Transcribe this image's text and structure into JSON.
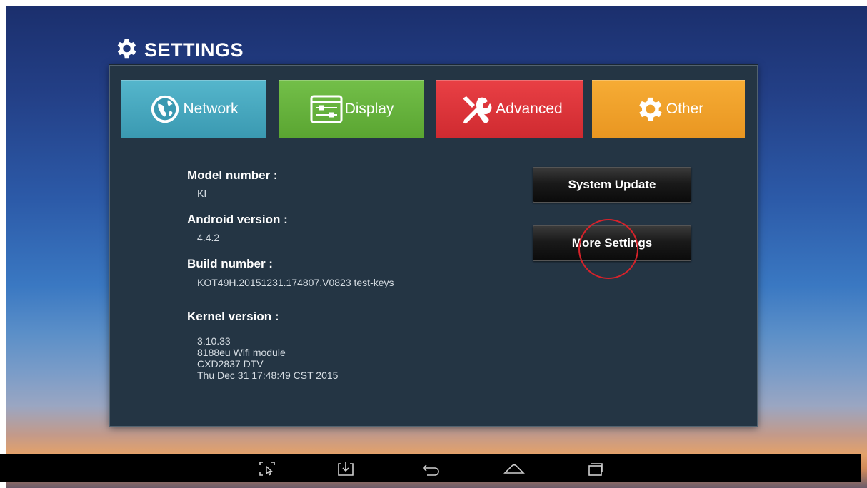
{
  "title": "SETTINGS",
  "tabs": [
    {
      "label": "Network",
      "icon": "globe-icon",
      "color": "#3fa3bb"
    },
    {
      "label": "Display",
      "icon": "display-settings-icon",
      "color": "#63ae3a"
    },
    {
      "label": "Advanced",
      "icon": "tools-icon",
      "color": "#dd3338"
    },
    {
      "label": "Other",
      "icon": "gear-icon",
      "color": "#f0a22a"
    }
  ],
  "info": {
    "model_label": "Model number :",
    "model_value": "KI",
    "android_label": "Android version :",
    "android_value": "4.4.2",
    "build_label": "Build number :",
    "build_value": "KOT49H.20151231.174807.V0823 test-keys",
    "kernel_label": "Kernel version :",
    "kernel_lines": [
      "3.10.33",
      "8188eu Wifi module",
      "CXD2837 DTV",
      "Thu Dec 31 17:48:49 CST 2015"
    ]
  },
  "buttons": {
    "system_update": "System Update",
    "more_settings": "More Settings"
  },
  "navbar": [
    "screenshot-icon",
    "download-icon",
    "back-icon",
    "home-icon",
    "recents-icon"
  ],
  "colors": {
    "panel": "#243544",
    "highlight_circle": "#d7222a"
  }
}
